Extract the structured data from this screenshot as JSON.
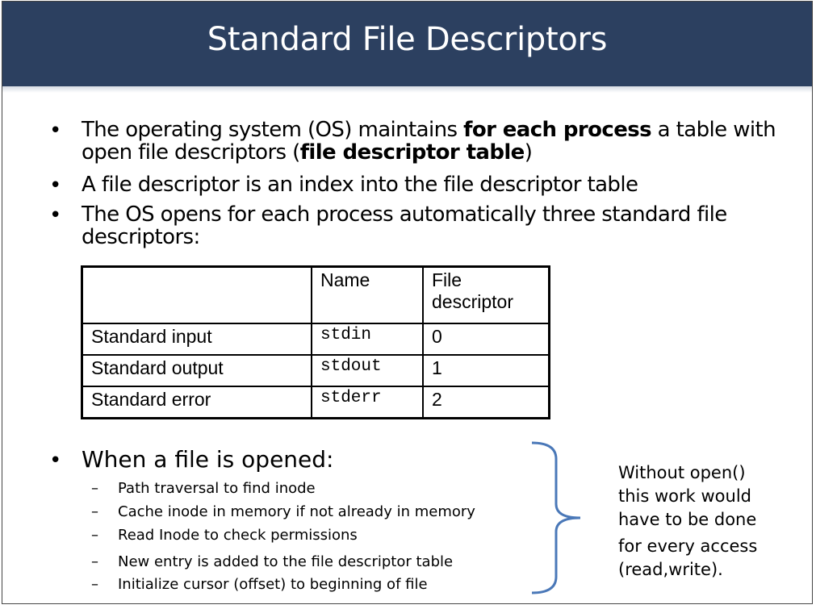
{
  "title": "Standard File Descriptors",
  "bullets": [
    {
      "pre": "The operating system (OS) maintains ",
      "bold1": "for each process",
      "mid": " a table with open file descriptors (",
      "bold2": "file descriptor table",
      "post": ")"
    },
    {
      "text": "A file descriptor is an index into the file descriptor table"
    },
    {
      "text": "The OS opens for each process automatically three standard file descriptors:"
    }
  ],
  "bullet_symbol": "•",
  "table": {
    "headers": [
      "",
      "Name",
      "File descriptor"
    ],
    "rows": [
      {
        "label": "Standard input",
        "name": "stdin",
        "fd": "0"
      },
      {
        "label": "Standard output",
        "name": "stdout",
        "fd": "1"
      },
      {
        "label": "Standard error",
        "name": "stderr",
        "fd": "2"
      }
    ]
  },
  "opened": {
    "heading": "When a file is opened:",
    "dash": "–",
    "steps": [
      "Path traversal to find inode",
      "Cache inode in memory if not already in memory",
      "Read Inode to check permissions",
      "New entry is added to the file descriptor table",
      "Initialize cursor (offset) to beginning of file"
    ]
  },
  "note": [
    "Without open()",
    "this work would",
    "have to be done",
    "for every access",
    "(read,write)."
  ],
  "colors": {
    "title_bg": "#2c4060",
    "brace": "#4a78b8"
  }
}
